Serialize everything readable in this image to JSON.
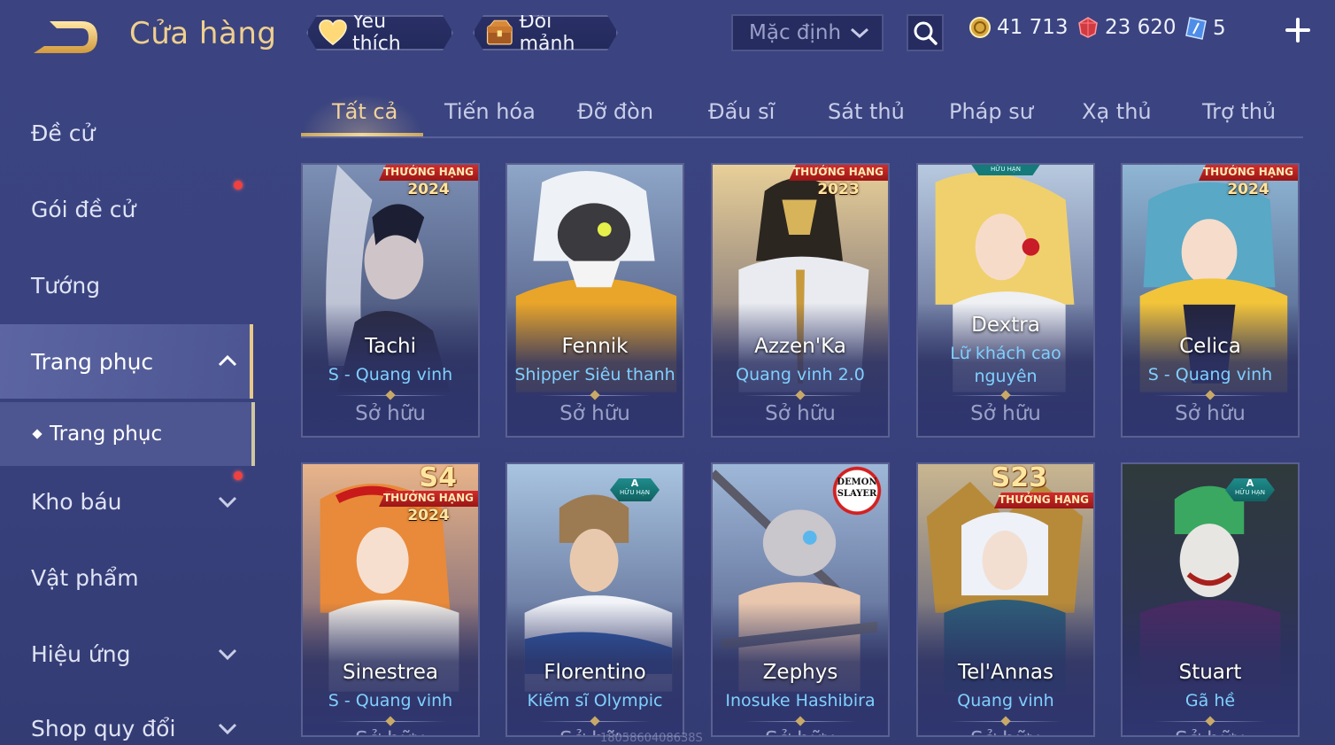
{
  "header": {
    "title": "Cửa hàng",
    "favorites_label": "Yêu thích",
    "exchange_label": "Đổi mảnh",
    "sort_value": "Mặc định",
    "gold": "41 713",
    "ruby": "23 620",
    "voucher": "5"
  },
  "sidebar": {
    "items": [
      {
        "label": "Đề cử"
      },
      {
        "label": "Gói đề cử"
      },
      {
        "label": "Tướng"
      },
      {
        "label": "Trang phục"
      },
      {
        "label": "Kho báu"
      },
      {
        "label": "Vật phẩm"
      },
      {
        "label": "Hiệu ứng"
      },
      {
        "label": "Shop quy đổi"
      }
    ],
    "sub_item": "Trang phục"
  },
  "tabs": [
    "Tất cả",
    "Tiến hóa",
    "Đỡ đòn",
    "Đấu sĩ",
    "Sát thủ",
    "Pháp sư",
    "Xạ thủ",
    "Trợ thủ"
  ],
  "cards": [
    {
      "name": "Tachi",
      "skin": "S - Quang vinh",
      "owned": "Sở hữu",
      "rank_label": "THƯỞNG HẠNG",
      "rank_year": "2024"
    },
    {
      "name": "Fennik",
      "skin": "Shipper Siêu thanh",
      "owned": "Sở hữu"
    },
    {
      "name": "Azzen'Ka",
      "skin": "Quang vinh 2.0",
      "owned": "Sở hữu",
      "rank_label": "THƯỞNG HẠNG",
      "rank_year": "2023"
    },
    {
      "name": "Dextra",
      "skin": "Lữ khách cao nguyên",
      "owned": "Sở hữu",
      "limited_label": "HỮU HẠN"
    },
    {
      "name": "Celica",
      "skin": "S - Quang vinh",
      "owned": "Sở hữu",
      "rank_label": "THƯỞNG HẠNG",
      "rank_year": "2024"
    },
    {
      "name": "Sinestrea",
      "skin": "S - Quang vinh",
      "owned": "Sở hữu",
      "season": "S4",
      "rank_label": "THƯỞNG HẠNG",
      "rank_year": "2024"
    },
    {
      "name": "Florentino",
      "skin": "Kiếm sĩ Olympic",
      "owned": "Sở hữu",
      "tier": "A",
      "limited_label": "HỮU HẠN"
    },
    {
      "name": "Zephys",
      "skin": "Inosuke Hashibira",
      "owned": "Sở hữu",
      "collab": "DEMON SLAYER"
    },
    {
      "name": "Tel'Annas",
      "skin": "Quang vinh",
      "owned": "Sở hữu",
      "season": "S23",
      "rank_label": "THƯỞNG HẠNG"
    },
    {
      "name": "Stuart",
      "skin": "Gã hề",
      "owned": "Sở hữu",
      "tier": "A",
      "limited_label": "HỮU HẠN"
    }
  ],
  "watermark": "1805860408638S",
  "colors": {
    "accent_gold": "#f0cf8e",
    "skin_blue": "#7fd0ff",
    "rank_red": "#d02c2c",
    "notification": "#f04040"
  },
  "icons": {
    "back": "back-arrow-icon",
    "heart": "heart-icon",
    "chest": "chest-icon",
    "search": "search-icon",
    "gold": "gold-coin-icon",
    "ruby": "ruby-gem-icon",
    "voucher": "voucher-icon",
    "plus": "plus-icon"
  }
}
